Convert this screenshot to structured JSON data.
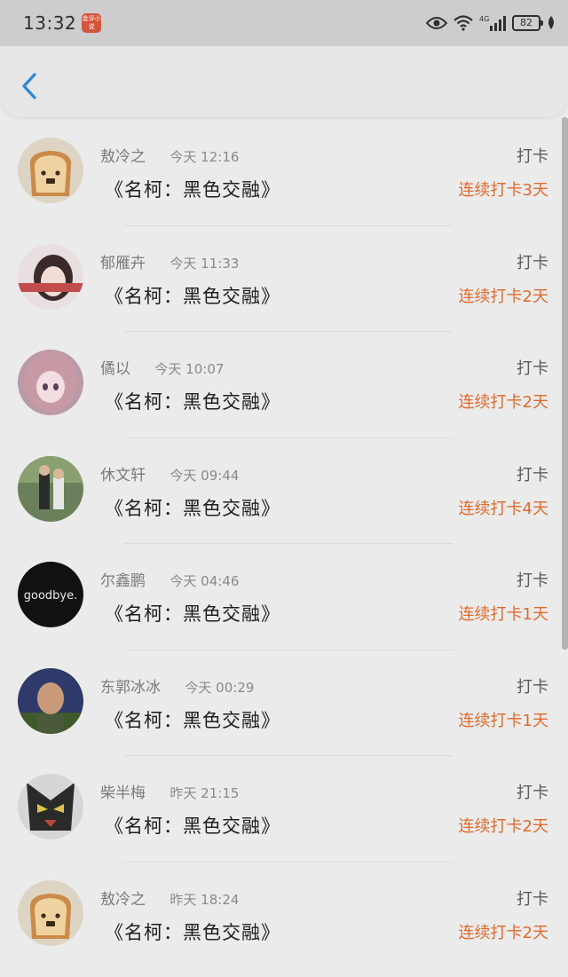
{
  "status_bar": {
    "time": "13:32",
    "app_badge": "金评小说",
    "battery": "82",
    "network": "4G"
  },
  "header": {
    "back_icon": "chevron-left-icon",
    "accent": "#2a88d6"
  },
  "colors": {
    "streak": "#e06a2c",
    "name": "#7b7b7b"
  },
  "records": [
    {
      "name": "敖冷之",
      "time": "今天 12:16",
      "book": "《名柯：黑色交融》",
      "action": "打卡",
      "streak": "连续打卡3天",
      "avatar": "toast"
    },
    {
      "name": "郁雁卉",
      "time": "今天 11:33",
      "book": "《名柯：黑色交融》",
      "action": "打卡",
      "streak": "连续打卡2天",
      "avatar": "girl"
    },
    {
      "name": "僪以",
      "time": "今天 10:07",
      "book": "《名柯：黑色交融》",
      "action": "打卡",
      "streak": "连续打卡2天",
      "avatar": "anime"
    },
    {
      "name": "休文轩",
      "time": "今天 09:44",
      "book": "《名柯：黑色交融》",
      "action": "打卡",
      "streak": "连续打卡4天",
      "avatar": "couple"
    },
    {
      "name": "尔鑫鹏",
      "time": "今天 04:46",
      "book": "《名柯：黑色交融》",
      "action": "打卡",
      "streak": "连续打卡1天",
      "avatar": "goodbye"
    },
    {
      "name": "东郭冰冰",
      "time": "今天 00:29",
      "book": "《名柯：黑色交融》",
      "action": "打卡",
      "streak": "连续打卡1天",
      "avatar": "man"
    },
    {
      "name": "柴半梅",
      "time": "昨天 21:15",
      "book": "《名柯：黑色交融》",
      "action": "打卡",
      "streak": "连续打卡2天",
      "avatar": "robot"
    },
    {
      "name": "敖冷之",
      "time": "昨天 18:24",
      "book": "《名柯：黑色交融》",
      "action": "打卡",
      "streak": "连续打卡2天",
      "avatar": "toast"
    }
  ],
  "avatar_texts": {
    "goodbye": "goodbye."
  }
}
